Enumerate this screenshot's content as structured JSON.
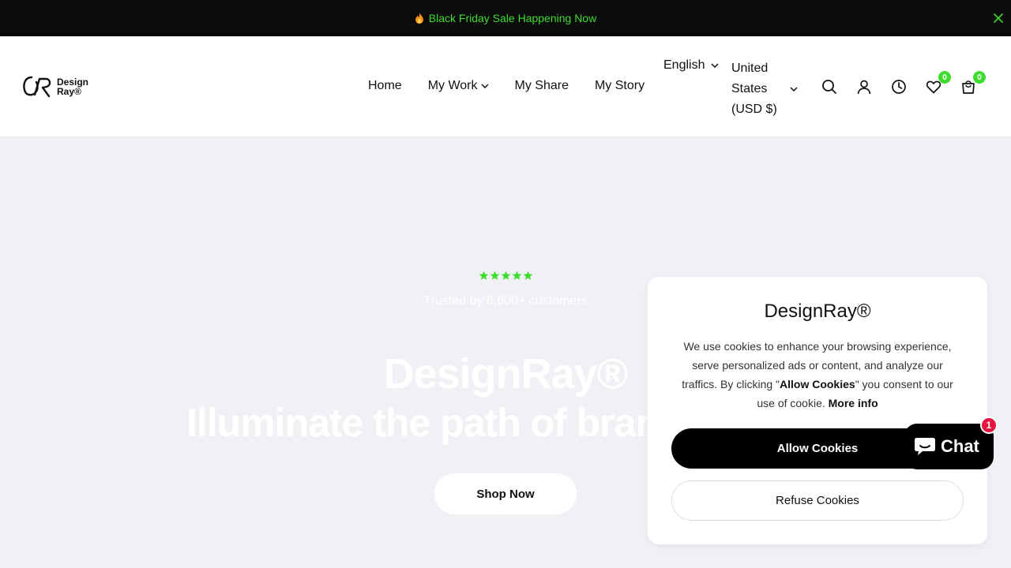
{
  "announcement": {
    "text": "Black Friday Sale Happening Now",
    "icon": "fire-icon",
    "color": "#3ddc2f"
  },
  "header": {
    "logo": {
      "line1": "Design",
      "line2": "Ray®"
    },
    "nav": [
      {
        "label": "Home",
        "has_dropdown": false
      },
      {
        "label": "My Work",
        "has_dropdown": true
      },
      {
        "label": "My Share",
        "has_dropdown": false
      },
      {
        "label": "My Story",
        "has_dropdown": false
      }
    ],
    "language": "English",
    "currency": "United States (USD $)",
    "icons": [
      "search-icon",
      "account-icon",
      "recently-viewed-icon",
      "wishlist-icon",
      "cart-icon"
    ],
    "wishlist_count": "0",
    "cart_count": "0"
  },
  "hero": {
    "rating_stars": 5,
    "trusted_text": "Trusted by 6,600+ customers",
    "title": "DesignRay®",
    "subtitle": "Illuminate the path of bran",
    "cta_label": "Shop Now"
  },
  "cookie": {
    "title": "DesignRay®",
    "body_1": "We use cookies to enhance your browsing experience, serve personalized ads or content, and analyze our traffics. By clicking \"",
    "body_bold": "Allow Cookies",
    "body_2": "\" you consent to our use of cookie. ",
    "more_info": "More info",
    "allow_label": "Allow Cookies",
    "refuse_label": "Refuse Cookies"
  },
  "chat": {
    "label": "Chat",
    "badge": "1"
  },
  "colors": {
    "accent_green": "#3ddc2f",
    "hero_bg": "#f0f1f5",
    "chat_badge": "#e4163f"
  }
}
